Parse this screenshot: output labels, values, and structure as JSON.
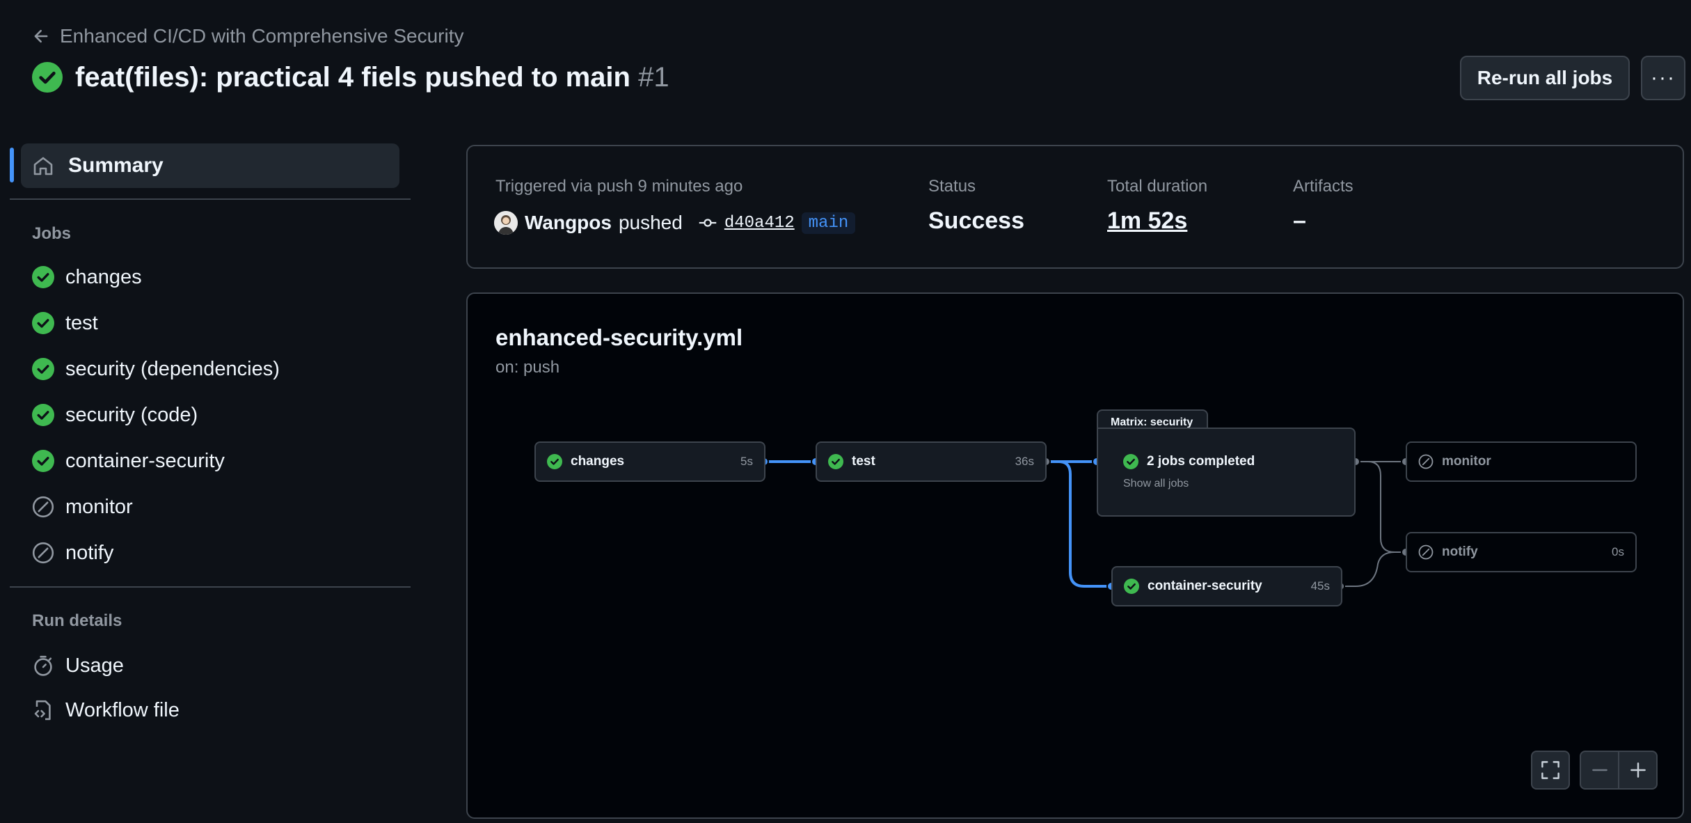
{
  "header": {
    "back_label": "Enhanced CI/CD with Comprehensive Security",
    "title": "feat(files): practical 4 fiels pushed to main",
    "run_number": "#1",
    "rerun_label": "Re-run all jobs",
    "more_label": "···"
  },
  "sidebar": {
    "summary_label": "Summary",
    "jobs_heading": "Jobs",
    "jobs": [
      {
        "label": "changes",
        "status": "success"
      },
      {
        "label": "test",
        "status": "success"
      },
      {
        "label": "security (dependencies)",
        "status": "success"
      },
      {
        "label": "security (code)",
        "status": "success"
      },
      {
        "label": "container-security",
        "status": "success"
      },
      {
        "label": "monitor",
        "status": "skipped"
      },
      {
        "label": "notify",
        "status": "skipped"
      }
    ],
    "run_details_heading": "Run details",
    "usage_label": "Usage",
    "workflow_file_label": "Workflow file"
  },
  "summary": {
    "trigger_text": "Triggered via push 9 minutes ago",
    "actor": "Wangpos",
    "pushed_word": "pushed",
    "commit": "d40a412",
    "branch": "main",
    "status_label": "Status",
    "status_value": "Success",
    "duration_label": "Total duration",
    "duration_value": "1m 52s",
    "artifacts_label": "Artifacts",
    "artifacts_value": "–"
  },
  "workflow": {
    "file": "enhanced-security.yml",
    "trigger": "on: push",
    "jobs": {
      "changes": {
        "name": "changes",
        "duration": "5s",
        "status": "success"
      },
      "test": {
        "name": "test",
        "duration": "36s",
        "status": "success"
      },
      "container": {
        "name": "container-security",
        "duration": "45s",
        "status": "success"
      },
      "monitor": {
        "name": "monitor",
        "duration": "",
        "status": "skipped"
      },
      "notify": {
        "name": "notify",
        "duration": "0s",
        "status": "skipped"
      }
    },
    "matrix": {
      "tab_label": "Matrix: security",
      "completed_label": "2 jobs completed",
      "show_all_label": "Show all jobs"
    }
  },
  "colors": {
    "success": "#3fb950",
    "accent": "#4493f8",
    "skipped": "#9198a1",
    "background": "#0d1117"
  },
  "icons": {
    "back": "arrow-left-icon",
    "success": "check-circle-fill-icon",
    "skipped": "skip-circle-icon",
    "home": "home-icon",
    "usage": "stopwatch-icon",
    "workflow_file": "file-code-icon",
    "commit": "git-commit-icon",
    "fullscreen": "screen-full-icon",
    "zoom_out": "dash-icon",
    "zoom_in": "plus-icon"
  }
}
